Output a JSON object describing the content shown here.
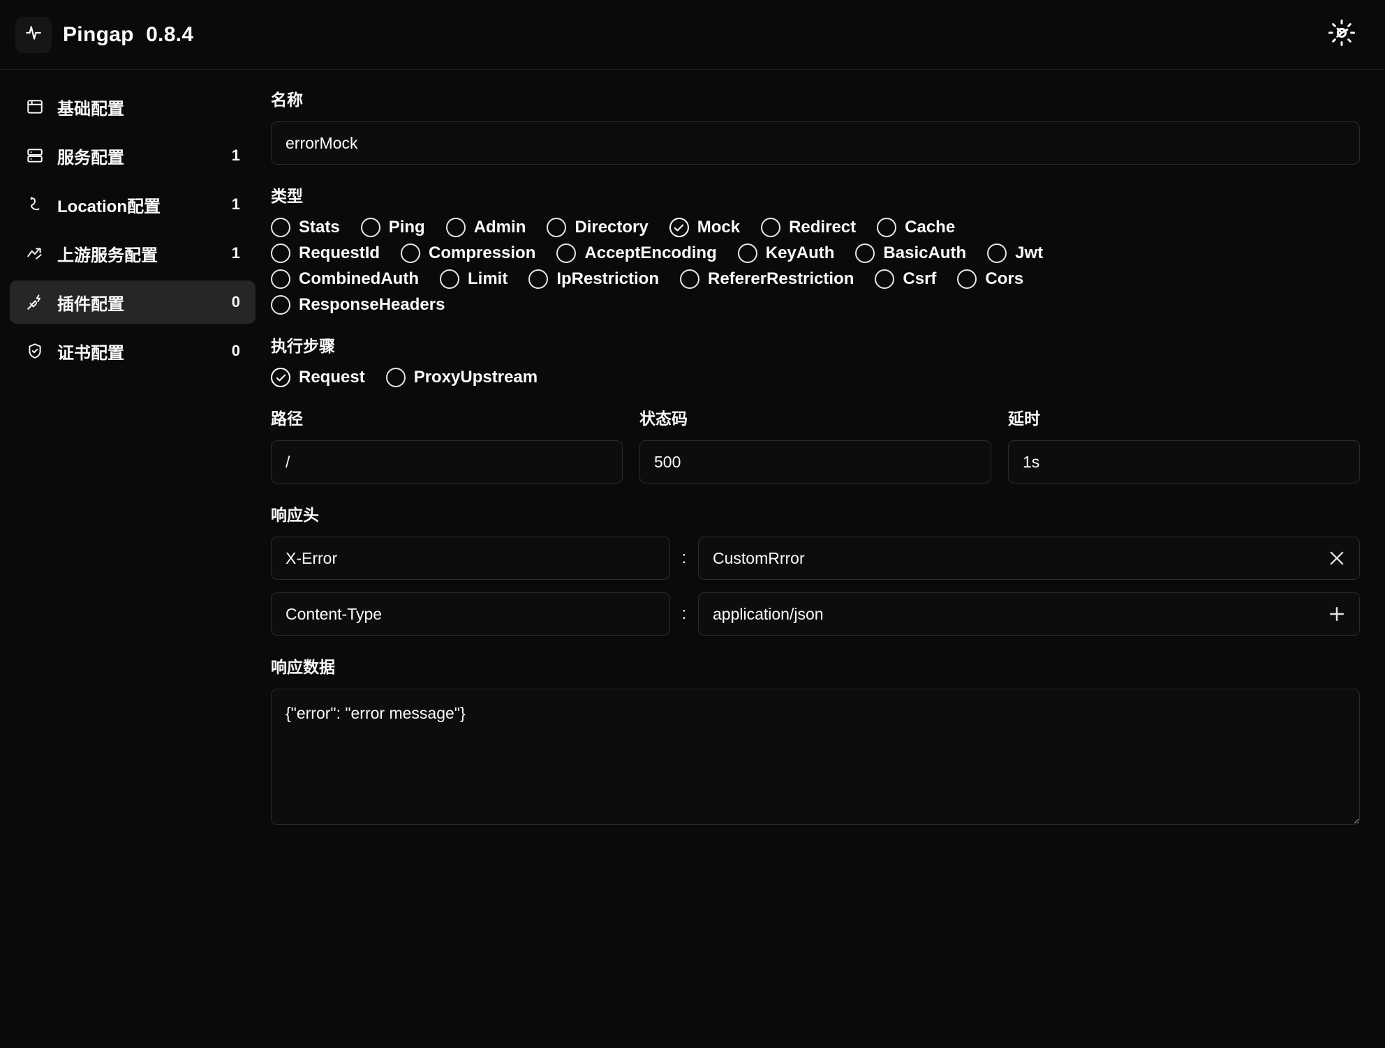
{
  "header": {
    "app_name": "Pingap",
    "version": "0.8.4",
    "title": "Pingap  0.8.4",
    "logo_icon": "activity-pulse-icon",
    "settings_icon": "gear-icon"
  },
  "sidebar": {
    "items": [
      {
        "label": "基础配置",
        "count": "",
        "icon": "window-icon",
        "active": false
      },
      {
        "label": "服务配置",
        "count": "1",
        "icon": "server-icon",
        "active": false
      },
      {
        "label": "Location配置",
        "count": "1",
        "icon": "route-icon",
        "active": false
      },
      {
        "label": "上游服务配置",
        "count": "1",
        "icon": "trending-up-icon",
        "active": false
      },
      {
        "label": "插件配置",
        "count": "0",
        "icon": "plug-zap-icon",
        "active": true
      },
      {
        "label": "证书配置",
        "count": "0",
        "icon": "shield-check-icon",
        "active": false
      }
    ]
  },
  "form": {
    "name": {
      "label": "名称",
      "value": "errorMock",
      "placeholder": ""
    },
    "type": {
      "label": "类型",
      "selected": "Mock",
      "rows": [
        [
          "Stats",
          "Ping",
          "Admin",
          "Directory",
          "Mock",
          "Redirect",
          "Cache"
        ],
        [
          "RequestId",
          "Compression",
          "AcceptEncoding",
          "KeyAuth",
          "BasicAuth",
          "Jwt"
        ],
        [
          "CombinedAuth",
          "Limit",
          "IpRestriction",
          "RefererRestriction",
          "Csrf",
          "Cors"
        ],
        [
          "ResponseHeaders"
        ]
      ]
    },
    "step": {
      "label": "执行步骤",
      "selected": "Request",
      "options": [
        "Request",
        "ProxyUpstream"
      ]
    },
    "path": {
      "label": "路径",
      "value": "/",
      "placeholder": ""
    },
    "status": {
      "label": "状态码",
      "value": "500",
      "placeholder": ""
    },
    "delay": {
      "label": "延时",
      "value": "1s",
      "placeholder": ""
    },
    "headers": {
      "label": "响应头",
      "separator": ":",
      "rows": [
        {
          "key": "X-Error",
          "value": "CustomRrror",
          "action": "remove-icon"
        },
        {
          "key": "Content-Type",
          "value": "application/json",
          "action": "add-icon"
        }
      ]
    },
    "data": {
      "label": "响应数据",
      "value": "{\"error\": \"error message\"}",
      "placeholder": ""
    }
  },
  "colors": {
    "background": "#0a0a0a",
    "panel": "#0d0d0d",
    "border": "#2b2b2b",
    "active": "#262626",
    "text": "#fafafa",
    "muted": "#6d6d6d"
  }
}
